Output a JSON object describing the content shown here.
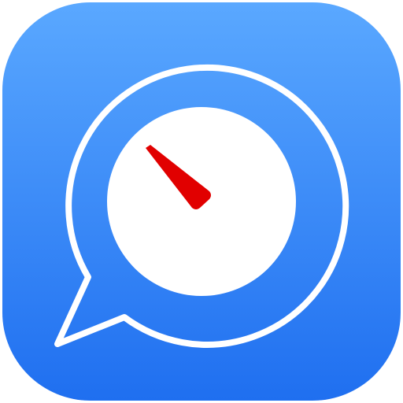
{
  "app_icon": {
    "icon": "speech-bubble-gauge-icon",
    "colors": {
      "background_top": "#5aa8ff",
      "background_bottom": "#1f6ff0",
      "outline": "#ffffff",
      "dial_face": "#ffffff",
      "needle": "#e10000"
    }
  }
}
